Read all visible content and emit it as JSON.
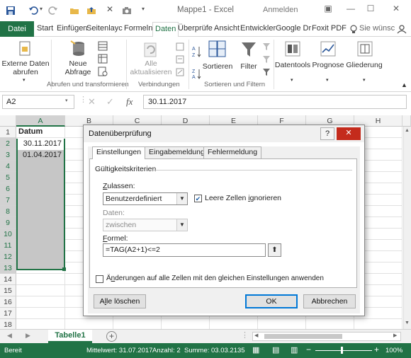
{
  "titlebar": {
    "title": "Mappe1 - Excel",
    "signin": "Anmelden",
    "minimize": "—",
    "maximize": "☐",
    "close": "✕"
  },
  "ribbon_tabs": {
    "file": "Datei",
    "tabs": [
      "Start",
      "Einfügen",
      "Seitenlayc",
      "Formeln",
      "Daten",
      "Überprüfe",
      "Ansicht",
      "Entwickler",
      "Google Dr",
      "Foxit PDF"
    ],
    "active": "Daten",
    "tell_me": "Sie wünsc"
  },
  "ribbon": {
    "external_data": "Externe Daten abrufen",
    "new_query": "Neue Abfrage",
    "refresh_all": "Alle aktualisieren",
    "sort": "Sortieren",
    "filter": "Filter",
    "data_tools": "Datentools",
    "forecast": "Prognose",
    "outline": "Gliederung",
    "group_get_transform": "Abrufen und transformieren",
    "group_connections": "Verbindungen",
    "group_sort_filter": "Sortieren und Filtern",
    "sort_az_icon": "sort-ascending-icon",
    "sort_za_icon": "sort-descending-icon"
  },
  "formula_bar": {
    "name_box": "A2",
    "fx": "fx",
    "value": "30.11.2017"
  },
  "grid": {
    "columns": [
      "A",
      "B",
      "C",
      "D",
      "E",
      "F",
      "G",
      "H"
    ],
    "rows": [
      "1",
      "2",
      "3",
      "4",
      "5",
      "6",
      "7",
      "8",
      "9",
      "10",
      "11",
      "12",
      "13",
      "14",
      "15",
      "16",
      "17",
      "18"
    ],
    "cells": {
      "A1": "Datum",
      "A2": "30.11.2017",
      "A3": "01.04.2017"
    }
  },
  "sheets": {
    "active": "Tabelle1",
    "add": "+"
  },
  "status": {
    "ready": "Bereit",
    "average": "Mittelwert: 31.07.2017",
    "count": "Anzahl: 2",
    "sum": "Summe: 03.03.2135",
    "zoom": "100%"
  },
  "dialog": {
    "title": "Datenüberprüfung",
    "help": "?",
    "close": "✕",
    "tabs": [
      "Einstellungen",
      "Eingabemeldung",
      "Fehlermeldung"
    ],
    "criteria_title": "Gültigkeitskriterien",
    "allow_label": "Zulassen:",
    "allow_value": "Benutzerdefiniert",
    "ignore_blank": "Leere Zellen ignorieren",
    "ignore_blank_checked": true,
    "data_label": "Daten:",
    "data_value": "zwischen",
    "formula_label": "Formel:",
    "formula_value": "=TAG(A2+1)<=2",
    "apply_all": "Änderungen auf alle Zellen mit den gleichen Einstellungen anwenden",
    "clear_all": "Alle löschen",
    "ok": "OK",
    "cancel": "Abbrechen"
  },
  "colors": {
    "excel_green": "#217346",
    "close_red": "#c42b1c"
  }
}
